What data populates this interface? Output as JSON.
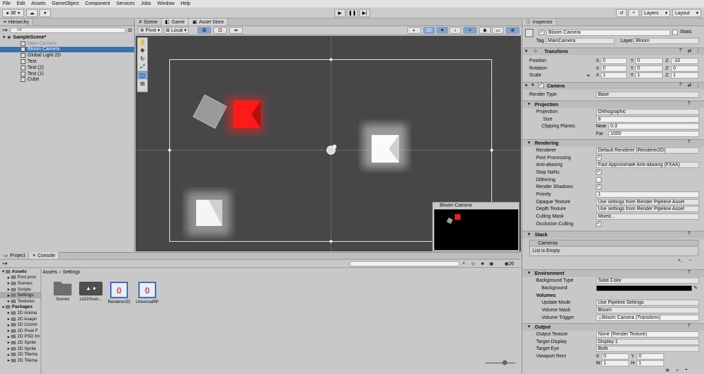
{
  "menu": [
    "File",
    "Edit",
    "Assets",
    "GameObject",
    "Component",
    "Services",
    "Jobs",
    "Window",
    "Help"
  ],
  "toolbar": {
    "account": "3E",
    "layers": "Layers",
    "layout": "Layout"
  },
  "hierarchy": {
    "tab": "Hierarchy",
    "search_placeholder": "All",
    "scene": "SampleScene*",
    "items": [
      "Main Camera",
      "Bloom Camera",
      "Global Light 2D",
      "Test",
      "Test (2)",
      "Test (1)",
      "Cube"
    ]
  },
  "scene_tabs": [
    "Scene",
    "Game",
    "Asset Store"
  ],
  "scene_toolbar": {
    "pivot": "Pivot",
    "local": "Local",
    "mode2d": "2D"
  },
  "preview": {
    "title": "Bloom Camera"
  },
  "inspector": {
    "tab": "Inspector",
    "name": "Bloom Camera",
    "static": "Static",
    "tag_label": "Tag",
    "tag": "MainCamera",
    "layer_label": "Layer",
    "layer": "Bloom",
    "transform": {
      "title": "Transform",
      "position": {
        "label": "Position",
        "x": "0",
        "y": "0",
        "z": "-10"
      },
      "rotation": {
        "label": "Rotation",
        "x": "0",
        "y": "0",
        "z": "0"
      },
      "scale": {
        "label": "Scale",
        "x": "1",
        "y": "1",
        "z": "1"
      }
    },
    "camera": {
      "title": "Camera",
      "render_type_label": "Render Type",
      "render_type": "Base",
      "projection_section": "Projection",
      "projection_label": "Projection",
      "projection": "Orthographic",
      "size_label": "Size",
      "size": "8",
      "clip_label": "Clipping Planes",
      "near_label": "Near",
      "near": "0.3",
      "far_label": "Far",
      "far": "1000",
      "rendering_section": "Rendering",
      "renderer_label": "Renderer",
      "renderer": "Default Renderer (Renderer2D)",
      "post_label": "Post Processing",
      "aa_label": "Anti-aliasing",
      "aa": "Fast Approximate Anti-aliasing (FXAA)",
      "stopnan_label": "Stop NaNs",
      "dither_label": "Dithering",
      "shadows_label": "Render Shadows",
      "priority_label": "Priority",
      "priority": "1",
      "opaque_label": "Opaque Texture",
      "opaque": "Use settings from Render Pipeline Asset",
      "depth_label": "Depth Texture",
      "depth": "Use settings from Render Pipeline Asset",
      "culling_label": "Culling Mask",
      "culling": "Mixed...",
      "occlusion_label": "Occlusion Culling",
      "stack_section": "Stack",
      "cameras_label": "Cameras",
      "stack_empty": "List is Empty",
      "env_section": "Environment",
      "bg_type_label": "Background Type",
      "bg_type": "Solid Color",
      "bg_label": "Background",
      "volumes_label": "Volumes",
      "update_mode_label": "Update Mode",
      "update_mode": "Use Pipeline Settings",
      "volume_mask_label": "Volume Mask",
      "volume_mask": "Bloom",
      "volume_trigger_label": "Volume Trigger",
      "volume_trigger": "Bloom Camera (Transform)",
      "output_section": "Output",
      "out_tex_label": "Output Texture",
      "out_tex": "None (Render Texture)",
      "target_disp_label": "Target Display",
      "target_disp": "Display 1",
      "target_eye_label": "Target Eye",
      "target_eye": "Both",
      "viewport_label": "Viewport Rect",
      "vx": "0",
      "vy": "0",
      "vw": "1",
      "vh": "1"
    }
  },
  "project": {
    "tabs": [
      "Project",
      "Console"
    ],
    "breadcrumb": [
      "Assets",
      "Settings"
    ],
    "count": "26",
    "tree": [
      {
        "label": "Assets",
        "bold": true,
        "indent": 0
      },
      {
        "label": "Post proc",
        "indent": 1
      },
      {
        "label": "Scenes",
        "indent": 1
      },
      {
        "label": "Scripts",
        "indent": 1
      },
      {
        "label": "Settings",
        "indent": 1,
        "selected": true
      },
      {
        "label": "Textures",
        "indent": 1
      },
      {
        "label": "Packages",
        "bold": true,
        "indent": 0
      },
      {
        "label": "2D Anima",
        "indent": 1
      },
      {
        "label": "2D Asepri",
        "indent": 1
      },
      {
        "label": "2D Comm",
        "indent": 1
      },
      {
        "label": "2D Pixel F",
        "indent": 1
      },
      {
        "label": "2D PSD Im",
        "indent": 1
      },
      {
        "label": "2D Sprite",
        "indent": 1
      },
      {
        "label": "2D Sprite",
        "indent": 1
      },
      {
        "label": "2D Tilema",
        "indent": 1
      },
      {
        "label": "2D Tilema",
        "indent": 1
      }
    ],
    "assets": [
      "Scenes",
      "Lit2DScen...",
      "Renderer2D",
      "UniversalRP"
    ]
  },
  "colors": {
    "selection": "#3a72b0",
    "viewport_bg": "#474747",
    "red_square": "#ff1a1a"
  }
}
